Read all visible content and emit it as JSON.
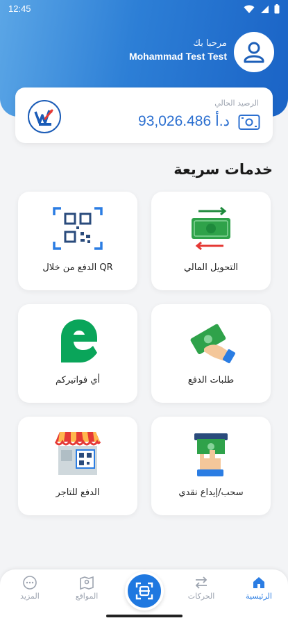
{
  "status_bar": {
    "time": "12:45"
  },
  "header": {
    "greeting": "مرحبا بك",
    "user_name": "Mohammad Test Test"
  },
  "balance": {
    "label": "الرصيد الحالي",
    "amount": "93,026.486 د.أ"
  },
  "quick_services": {
    "title": "خدمات سريعة",
    "items": [
      {
        "label": "التحويل المالي",
        "icon": "money-transfer-icon"
      },
      {
        "label": "الدفع من خلال QR",
        "icon": "qr-code-icon"
      },
      {
        "label": "طلبات الدفع",
        "icon": "payment-request-icon"
      },
      {
        "label": "أي فواتيركم",
        "icon": "efawateercom-icon"
      },
      {
        "label": "سحب/إيداع نقدي",
        "icon": "cash-withdraw-icon"
      },
      {
        "label": "الدفع للتاجر",
        "icon": "merchant-store-icon"
      }
    ]
  },
  "bottom_nav": {
    "items": [
      {
        "label": "الرئيسية",
        "icon": "home-icon",
        "active": true
      },
      {
        "label": "الحركات",
        "icon": "transactions-icon",
        "active": false
      },
      {
        "label": "المواقع",
        "icon": "map-icon",
        "active": false
      },
      {
        "label": "المزيد",
        "icon": "more-icon",
        "active": false
      }
    ]
  },
  "colors": {
    "primary": "#2b7de3",
    "header_gradient_start": "#5ba6e6",
    "header_gradient_end": "#1a63c6",
    "green": "#1e8a3c"
  }
}
